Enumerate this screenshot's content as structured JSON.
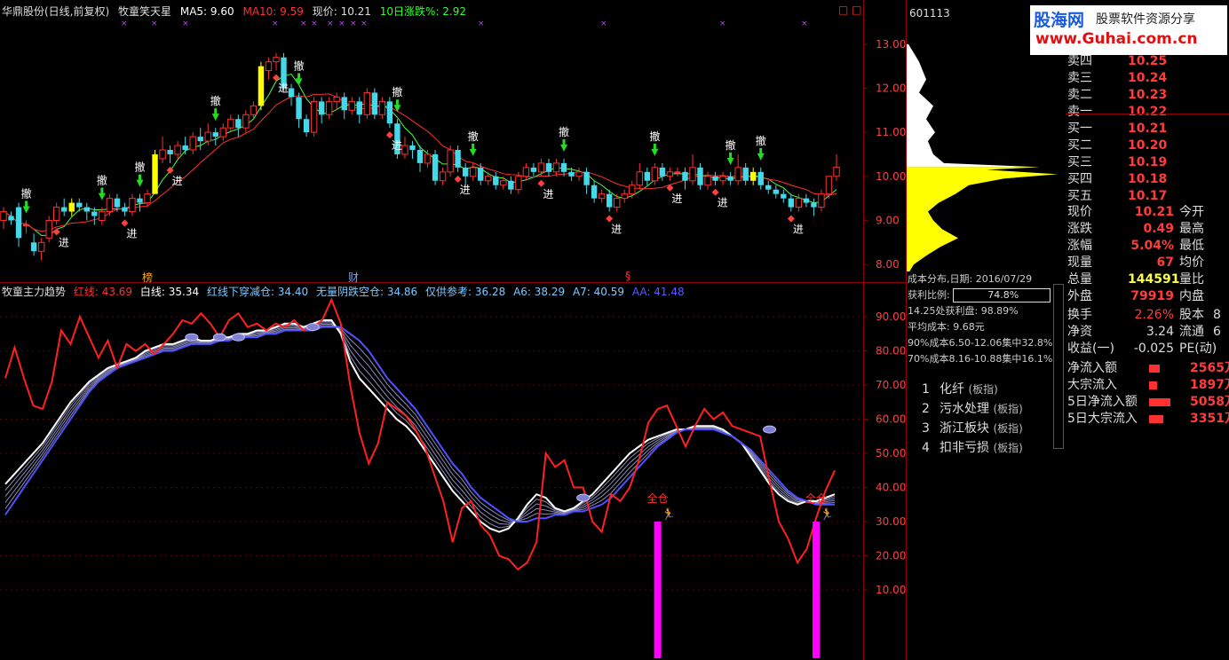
{
  "header": {
    "stock_name": "华鼎股份(日线,前复权)",
    "indicator_name": "牧童笑天星",
    "ma5": "MA5: 9.60",
    "ma10": "MA10: 9.59",
    "price": "现价: 10.21",
    "rise10": "10日涨跌%: 2.92"
  },
  "sub_header": {
    "name": "牧童主力趋势",
    "red": "红线: 43.69",
    "white": "白线: 35.34",
    "cross": "红线下穿减仓: 34.40",
    "noyin": "无量阴跌空仓: 34.86",
    "ref": "仅供参考: 36.28",
    "a6": "A6: 38.29",
    "a7": "A7: 40.59",
    "aa": "AA: 41.48"
  },
  "event_markers": {
    "bang": "榜",
    "cai": "财",
    "s": "§"
  },
  "chart_data": [
    {
      "type": "candlestick",
      "y_ticks": [
        "13.00",
        "12.00",
        "11.00",
        "10.00",
        "9.00",
        "8.00"
      ],
      "ylim": [
        7.6,
        13.6
      ],
      "signal_sell": "撤",
      "signal_buy": "进",
      "candles": [
        [
          9.0,
          9.2,
          8.8,
          9.3
        ],
        [
          9.1,
          9.0,
          8.9,
          9.2
        ],
        [
          9.3,
          8.6,
          8.4,
          9.4
        ],
        [
          8.9,
          8.9,
          8.7,
          9.0
        ],
        [
          8.5,
          8.3,
          8.2,
          8.7
        ],
        [
          8.3,
          8.5,
          8.1,
          8.6
        ],
        [
          8.6,
          9.0,
          8.5,
          9.1
        ],
        [
          9.0,
          9.3,
          8.9,
          9.4
        ],
        [
          9.3,
          9.2,
          9.1,
          9.5
        ],
        [
          9.2,
          9.4,
          9.1,
          9.5
        ],
        [
          9.4,
          9.3,
          9.2,
          9.5
        ],
        [
          9.3,
          9.2,
          9.0,
          9.4
        ],
        [
          9.2,
          9.1,
          8.9,
          9.3
        ],
        [
          9.0,
          9.2,
          8.9,
          9.3
        ],
        [
          9.2,
          9.5,
          9.1,
          9.6
        ],
        [
          9.5,
          9.3,
          9.2,
          9.6
        ],
        [
          9.3,
          9.2,
          9.1,
          9.4
        ],
        [
          9.2,
          9.5,
          9.1,
          9.6
        ],
        [
          9.5,
          9.4,
          9.2,
          9.6
        ],
        [
          9.4,
          9.6,
          9.3,
          9.7
        ],
        [
          9.6,
          10.5,
          9.6,
          10.6
        ],
        [
          10.4,
          10.6,
          10.3,
          10.9
        ],
        [
          10.6,
          10.5,
          10.3,
          10.7
        ],
        [
          10.5,
          10.7,
          10.4,
          10.8
        ],
        [
          10.7,
          10.6,
          10.5,
          10.9
        ],
        [
          10.6,
          10.9,
          10.5,
          11.0
        ],
        [
          10.9,
          10.8,
          10.6,
          11.1
        ],
        [
          10.8,
          11.0,
          10.7,
          11.2
        ],
        [
          11.0,
          10.9,
          10.7,
          11.1
        ],
        [
          10.9,
          11.1,
          10.8,
          11.2
        ],
        [
          11.1,
          11.3,
          11.0,
          11.4
        ],
        [
          11.3,
          11.1,
          10.9,
          11.4
        ],
        [
          11.1,
          11.4,
          11.0,
          11.5
        ],
        [
          11.4,
          11.6,
          11.3,
          11.7
        ],
        [
          11.6,
          12.5,
          11.5,
          12.6
        ],
        [
          12.4,
          12.6,
          12.2,
          12.7
        ],
        [
          12.6,
          12.7,
          12.4,
          12.8
        ],
        [
          12.7,
          12.0,
          11.9,
          12.8
        ],
        [
          12.0,
          11.8,
          11.6,
          12.1
        ],
        [
          11.8,
          11.3,
          11.1,
          11.9
        ],
        [
          11.3,
          11.0,
          10.9,
          11.4
        ],
        [
          11.0,
          11.7,
          10.9,
          11.8
        ],
        [
          11.7,
          11.4,
          11.2,
          11.8
        ],
        [
          11.4,
          11.7,
          11.3,
          11.8
        ],
        [
          11.7,
          11.8,
          11.5,
          11.9
        ],
        [
          11.8,
          11.5,
          11.3,
          11.9
        ],
        [
          11.5,
          11.7,
          11.4,
          11.8
        ],
        [
          11.7,
          11.4,
          11.2,
          11.8
        ],
        [
          11.4,
          11.9,
          11.3,
          12.0
        ],
        [
          11.9,
          11.4,
          11.3,
          12.0
        ],
        [
          11.4,
          11.7,
          11.3,
          11.8
        ],
        [
          11.7,
          11.2,
          11.1,
          11.8
        ],
        [
          11.2,
          10.5,
          10.4,
          11.3
        ],
        [
          10.5,
          10.7,
          10.4,
          10.9
        ],
        [
          10.7,
          10.6,
          10.4,
          10.8
        ],
        [
          10.6,
          10.3,
          10.1,
          10.7
        ],
        [
          10.3,
          10.5,
          10.2,
          10.6
        ],
        [
          10.5,
          9.9,
          9.8,
          10.6
        ],
        [
          9.9,
          10.1,
          9.8,
          10.2
        ],
        [
          10.1,
          10.6,
          10.0,
          10.7
        ],
        [
          10.6,
          10.2,
          10.1,
          10.7
        ],
        [
          10.2,
          10.0,
          9.8,
          10.3
        ],
        [
          10.0,
          10.2,
          9.9,
          10.3
        ],
        [
          10.2,
          9.9,
          9.8,
          10.3
        ],
        [
          9.9,
          10.0,
          9.8,
          10.1
        ],
        [
          10.0,
          9.8,
          9.7,
          10.1
        ],
        [
          9.8,
          9.9,
          9.7,
          10.0
        ],
        [
          9.9,
          9.7,
          9.6,
          10.0
        ],
        [
          9.7,
          10.0,
          9.6,
          10.1
        ],
        [
          10.0,
          10.2,
          9.9,
          10.3
        ],
        [
          10.2,
          10.1,
          10.0,
          10.3
        ],
        [
          10.1,
          10.3,
          10.0,
          10.4
        ],
        [
          10.3,
          10.1,
          10.0,
          10.4
        ],
        [
          10.1,
          10.3,
          10.0,
          10.4
        ],
        [
          10.3,
          10.1,
          10.0,
          10.4
        ],
        [
          10.1,
          10.0,
          9.9,
          10.2
        ],
        [
          10.0,
          10.1,
          9.9,
          10.2
        ],
        [
          10.1,
          9.8,
          9.6,
          10.2
        ],
        [
          9.8,
          9.5,
          9.4,
          9.9
        ],
        [
          9.5,
          9.6,
          9.4,
          9.7
        ],
        [
          9.6,
          9.3,
          9.2,
          9.7
        ],
        [
          9.3,
          9.5,
          9.2,
          9.6
        ],
        [
          9.5,
          9.6,
          9.4,
          9.7
        ],
        [
          9.6,
          9.8,
          9.5,
          9.9
        ],
        [
          9.8,
          10.1,
          9.7,
          10.3
        ],
        [
          10.1,
          9.9,
          9.8,
          10.2
        ],
        [
          9.9,
          10.2,
          9.8,
          10.3
        ],
        [
          10.2,
          10.0,
          9.9,
          10.3
        ],
        [
          10.0,
          10.1,
          9.9,
          10.2
        ],
        [
          10.1,
          10.1,
          10.0,
          10.2
        ],
        [
          10.1,
          9.9,
          9.7,
          10.2
        ],
        [
          9.9,
          10.2,
          9.8,
          10.5
        ],
        [
          10.2,
          9.8,
          9.7,
          10.3
        ],
        [
          9.8,
          10.0,
          9.7,
          10.1
        ],
        [
          10.0,
          9.9,
          9.8,
          10.1
        ],
        [
          9.9,
          10.0,
          9.8,
          10.1
        ],
        [
          10.0,
          9.9,
          9.8,
          10.1
        ],
        [
          9.9,
          10.2,
          9.8,
          10.5
        ],
        [
          10.2,
          9.9,
          9.8,
          10.3
        ],
        [
          9.9,
          10.1,
          9.8,
          10.2
        ],
        [
          10.1,
          9.8,
          9.7,
          10.2
        ],
        [
          9.8,
          9.7,
          9.6,
          9.9
        ],
        [
          9.7,
          9.6,
          9.5,
          9.8
        ],
        [
          9.6,
          9.5,
          9.4,
          9.7
        ],
        [
          9.5,
          9.3,
          9.2,
          9.6
        ],
        [
          9.3,
          9.5,
          9.2,
          9.6
        ],
        [
          9.5,
          9.4,
          9.3,
          9.6
        ],
        [
          9.4,
          9.3,
          9.1,
          9.5
        ],
        [
          9.3,
          9.6,
          9.2,
          9.7
        ],
        [
          9.6,
          10.0,
          9.5,
          10.0
        ],
        [
          10.0,
          10.21,
          9.9,
          10.5
        ]
      ],
      "sell_idx": [
        3,
        13,
        18,
        28,
        39,
        52,
        62,
        74,
        86,
        96,
        100
      ],
      "buy_idx": [
        7,
        16,
        22,
        36,
        51,
        60,
        71,
        80,
        88,
        94,
        104
      ],
      "yellow_idx": [
        9,
        20,
        34,
        99
      ]
    },
    {
      "type": "line",
      "y_ticks": [
        "90.00",
        "80.00",
        "70.00",
        "60.00",
        "50.00",
        "40.00",
        "30.00",
        "20.00",
        "10.00"
      ],
      "ylim": [
        -10,
        96
      ],
      "red": [
        72,
        81,
        72,
        64,
        63,
        71,
        86,
        82,
        90,
        84,
        78,
        83,
        75,
        82,
        80,
        82,
        79,
        82,
        85,
        89,
        88,
        91,
        88,
        84,
        89,
        91,
        87,
        88,
        86,
        88,
        87,
        89,
        86,
        87,
        89,
        95,
        88,
        70,
        56,
        47,
        53,
        65,
        63,
        61,
        57,
        52,
        44,
        36,
        24,
        34,
        36,
        29,
        26,
        20,
        19,
        16,
        18,
        24,
        50,
        46,
        48,
        40,
        40,
        30,
        27,
        38,
        36,
        40,
        48,
        59,
        63,
        64,
        58,
        52,
        58,
        63,
        60,
        62,
        58,
        57,
        56,
        55,
        42,
        30,
        25,
        18,
        22,
        31,
        39,
        45
      ],
      "white": [
        41,
        44,
        47,
        50,
        53,
        57,
        61,
        65,
        68,
        71,
        73,
        75,
        76,
        77,
        78,
        80,
        81,
        82,
        82,
        83,
        84,
        83,
        83,
        84,
        84,
        85,
        85,
        86,
        86,
        87,
        88,
        88,
        87,
        88,
        89,
        89,
        85,
        77,
        72,
        69,
        66,
        63,
        60,
        58,
        55,
        51,
        47,
        43,
        39,
        36,
        33,
        30,
        28,
        27,
        28,
        31,
        35,
        38,
        37,
        34,
        33,
        34,
        36,
        38,
        41,
        44,
        47,
        50,
        52,
        54,
        55,
        56,
        57,
        57,
        58,
        58,
        58,
        57,
        55,
        53,
        49,
        45,
        41,
        38,
        36,
        35,
        36,
        36,
        37,
        38
      ],
      "blue": [
        32,
        36,
        40,
        44,
        48,
        52,
        56,
        60,
        64,
        68,
        71,
        73,
        75,
        76,
        77,
        78,
        79,
        80,
        80,
        81,
        82,
        82,
        82,
        83,
        83,
        84,
        84,
        84,
        85,
        85,
        86,
        86,
        86,
        86,
        87,
        87,
        87,
        85,
        83,
        80,
        76,
        72,
        69,
        66,
        63,
        59,
        55,
        51,
        47,
        44,
        40,
        37,
        35,
        33,
        31,
        30,
        30,
        31,
        31,
        32,
        32,
        33,
        33,
        34,
        35,
        37,
        40,
        43,
        46,
        49,
        52,
        54,
        56,
        57,
        57,
        57,
        57,
        56,
        55,
        53,
        51,
        48,
        45,
        42,
        39,
        37,
        36,
        35,
        35,
        35
      ],
      "full_position_label": "全仓",
      "full_position_idx": [
        70,
        87
      ],
      "full_position_value": 30
    }
  ],
  "cost_panel": {
    "code": "601113",
    "date_label": "成本分布,日期: 2016/07/29",
    "profit_ratio_label": "获利比例:",
    "profit_ratio": "74.8%",
    "line1": "14.25处获利盘: 98.89%",
    "line2": "平均成本: 9.68元",
    "line3": "90%成本6.50-12.06集中32.8%",
    "line4": "70%成本8.16-10.88集中16.1%"
  },
  "sectors": [
    {
      "no": "1",
      "name": "化纤",
      "tag": "(板指)"
    },
    {
      "no": "2",
      "name": "污水处理",
      "tag": "(板指)"
    },
    {
      "no": "3",
      "name": "浙江板块",
      "tag": "(板指)"
    },
    {
      "no": "4",
      "name": "扣非亏损",
      "tag": "(板指)"
    }
  ],
  "logo": {
    "title": "股海网",
    "slogan": "股票软件资源分享",
    "url": "www.Guhai.com.cn"
  },
  "quotes": [
    {
      "label": "卖四",
      "value": "10.25"
    },
    {
      "label": "卖三",
      "value": "10.24"
    },
    {
      "label": "卖二",
      "value": "10.23"
    },
    {
      "label": "卖一",
      "value": "10.22"
    },
    {
      "label": "买一",
      "value": "10.21"
    },
    {
      "label": "买二",
      "value": "10.20"
    },
    {
      "label": "买三",
      "value": "10.19"
    },
    {
      "label": "买四",
      "value": "10.18"
    },
    {
      "label": "买五",
      "value": "10.17"
    }
  ],
  "stats": [
    {
      "l1": "现价",
      "v1": "10.21",
      "l2": "今开"
    },
    {
      "l1": "涨跌",
      "v1": "0.49",
      "l2": "最高"
    },
    {
      "l1": "涨幅",
      "v1": "5.04%",
      "l2": "最低"
    },
    {
      "l1": "现量",
      "v1": "67",
      "l2": "均价"
    },
    {
      "l1": "总量",
      "v1": "144591",
      "l2": "量比"
    },
    {
      "l1": "外盘",
      "v1": "79919",
      "l2": "内盘"
    }
  ],
  "stats2": [
    {
      "l1": "换手",
      "v1": "2.26%",
      "l2": "股本",
      "v2": "8"
    },
    {
      "l1": "净资",
      "v1": "3.24",
      "l2": "流通",
      "v2": "6"
    },
    {
      "l1": "收益(一)",
      "v1": "-0.025",
      "l2": "PE(动)",
      "v2": ""
    }
  ],
  "flows": [
    {
      "label": "净流入额",
      "value": "2565万",
      "pct": 0.25
    },
    {
      "label": "大宗流入",
      "value": "1897万",
      "pct": 0.18
    },
    {
      "label": "5日净流入额",
      "value": "5058万",
      "pct": 0.5
    },
    {
      "label": "5日大宗流入",
      "value": "3351万",
      "pct": 0.33
    }
  ],
  "colors": {
    "up": "#ff3030",
    "down": "#44d8e8",
    "ma5": "#ffffff",
    "ma10": "#ff3030",
    "axis": "#8b0000",
    "red_line": "#ff2020",
    "white_line": "#ffffff",
    "blue_line": "#5050ff",
    "magenta": "#ff00ff",
    "yellow": "#ffff00"
  }
}
